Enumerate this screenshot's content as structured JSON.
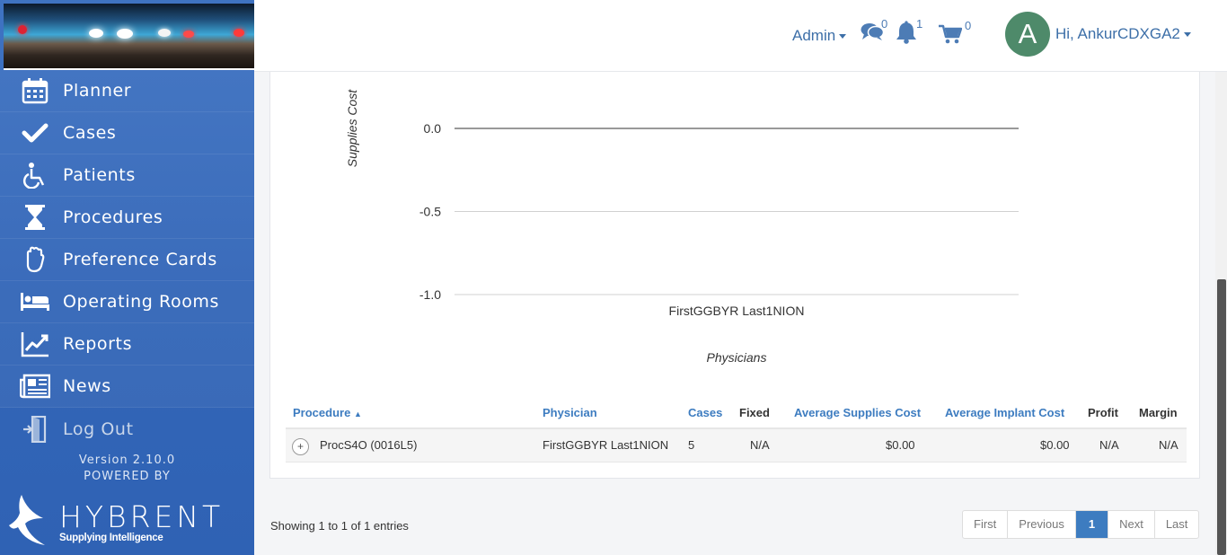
{
  "sidebar": {
    "items": [
      {
        "label": "Planner",
        "icon": "calendar-icon"
      },
      {
        "label": "Cases",
        "icon": "check-icon"
      },
      {
        "label": "Patients",
        "icon": "wheelchair-icon"
      },
      {
        "label": "Procedures",
        "icon": "hourglass-icon"
      },
      {
        "label": "Preference Cards",
        "icon": "glove-icon"
      },
      {
        "label": "Operating Rooms",
        "icon": "bed-icon"
      },
      {
        "label": "Reports",
        "icon": "line-chart-icon"
      },
      {
        "label": "News",
        "icon": "newspaper-icon"
      }
    ],
    "logout": {
      "label": "Log Out",
      "icon": "sign-out-icon"
    },
    "version": "Version 2.10.0",
    "powered_by": "POWERED BY",
    "brand": {
      "name": "HYBRENT",
      "tagline": "Supplying Intelligence"
    }
  },
  "header": {
    "admin_label": "Admin",
    "messages_count": "0",
    "notifications_count": "1",
    "cart_count": "0",
    "avatar_letter": "A",
    "user_greeting": "Hi, AnkurCDXGA2"
  },
  "chart_data": {
    "type": "bar",
    "categories": [
      "FirstGGBYR Last1NION"
    ],
    "values": [
      0.0
    ],
    "xlabel": "Physicians",
    "ylabel": "Supplies Cost",
    "yticks": [
      "0.0",
      "-0.5",
      "-1.0"
    ],
    "ylim": [
      -1.0,
      0.0
    ],
    "grid": true
  },
  "table": {
    "columns": [
      "Procedure",
      "Physician",
      "Cases",
      "Fixed",
      "Average Supplies Cost",
      "Average Implant Cost",
      "Profit",
      "Margin"
    ],
    "rows": [
      {
        "procedure": "ProcS4O (0016L5)",
        "physician": "FirstGGBYR Last1NION",
        "cases": "5",
        "fixed": "N/A",
        "avg_supplies_cost": "$0.00",
        "avg_implant_cost": "$0.00",
        "profit": "N/A",
        "margin": "N/A"
      }
    ]
  },
  "pagination": {
    "info": "Showing 1 to 1 of 1 entries",
    "first": "First",
    "previous": "Previous",
    "current": "1",
    "next": "Next",
    "last": "Last"
  },
  "colors": {
    "sidebar": "#3a6dbd",
    "link": "#3d7cc0",
    "avatar": "#4e8a6a"
  }
}
